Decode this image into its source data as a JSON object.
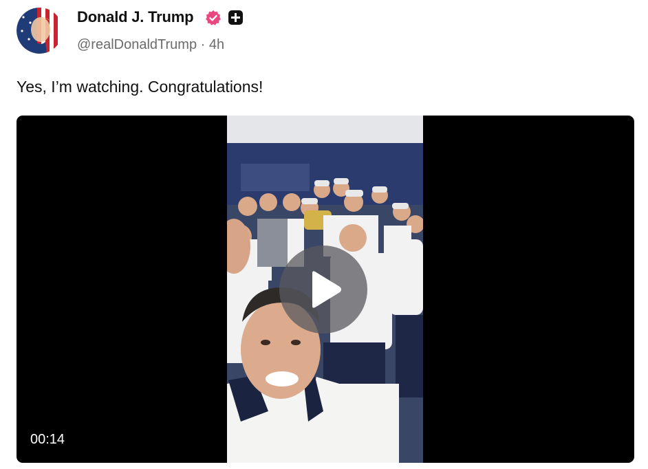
{
  "post": {
    "author_name": "Donald J. Trump",
    "handle": "@realDonaldTrump",
    "separator": "·",
    "time_ago": "4h",
    "text": "Yes, I’m watching. Congratulations!"
  },
  "icons": {
    "verified": "verified-badge-icon",
    "plus": "plus-badge-icon",
    "play": "play-icon"
  },
  "colors": {
    "verified_badge": "#e8477f",
    "video_background": "#000000",
    "play_overlay": "#5a5a5f"
  },
  "video": {
    "duration": "00:14"
  }
}
